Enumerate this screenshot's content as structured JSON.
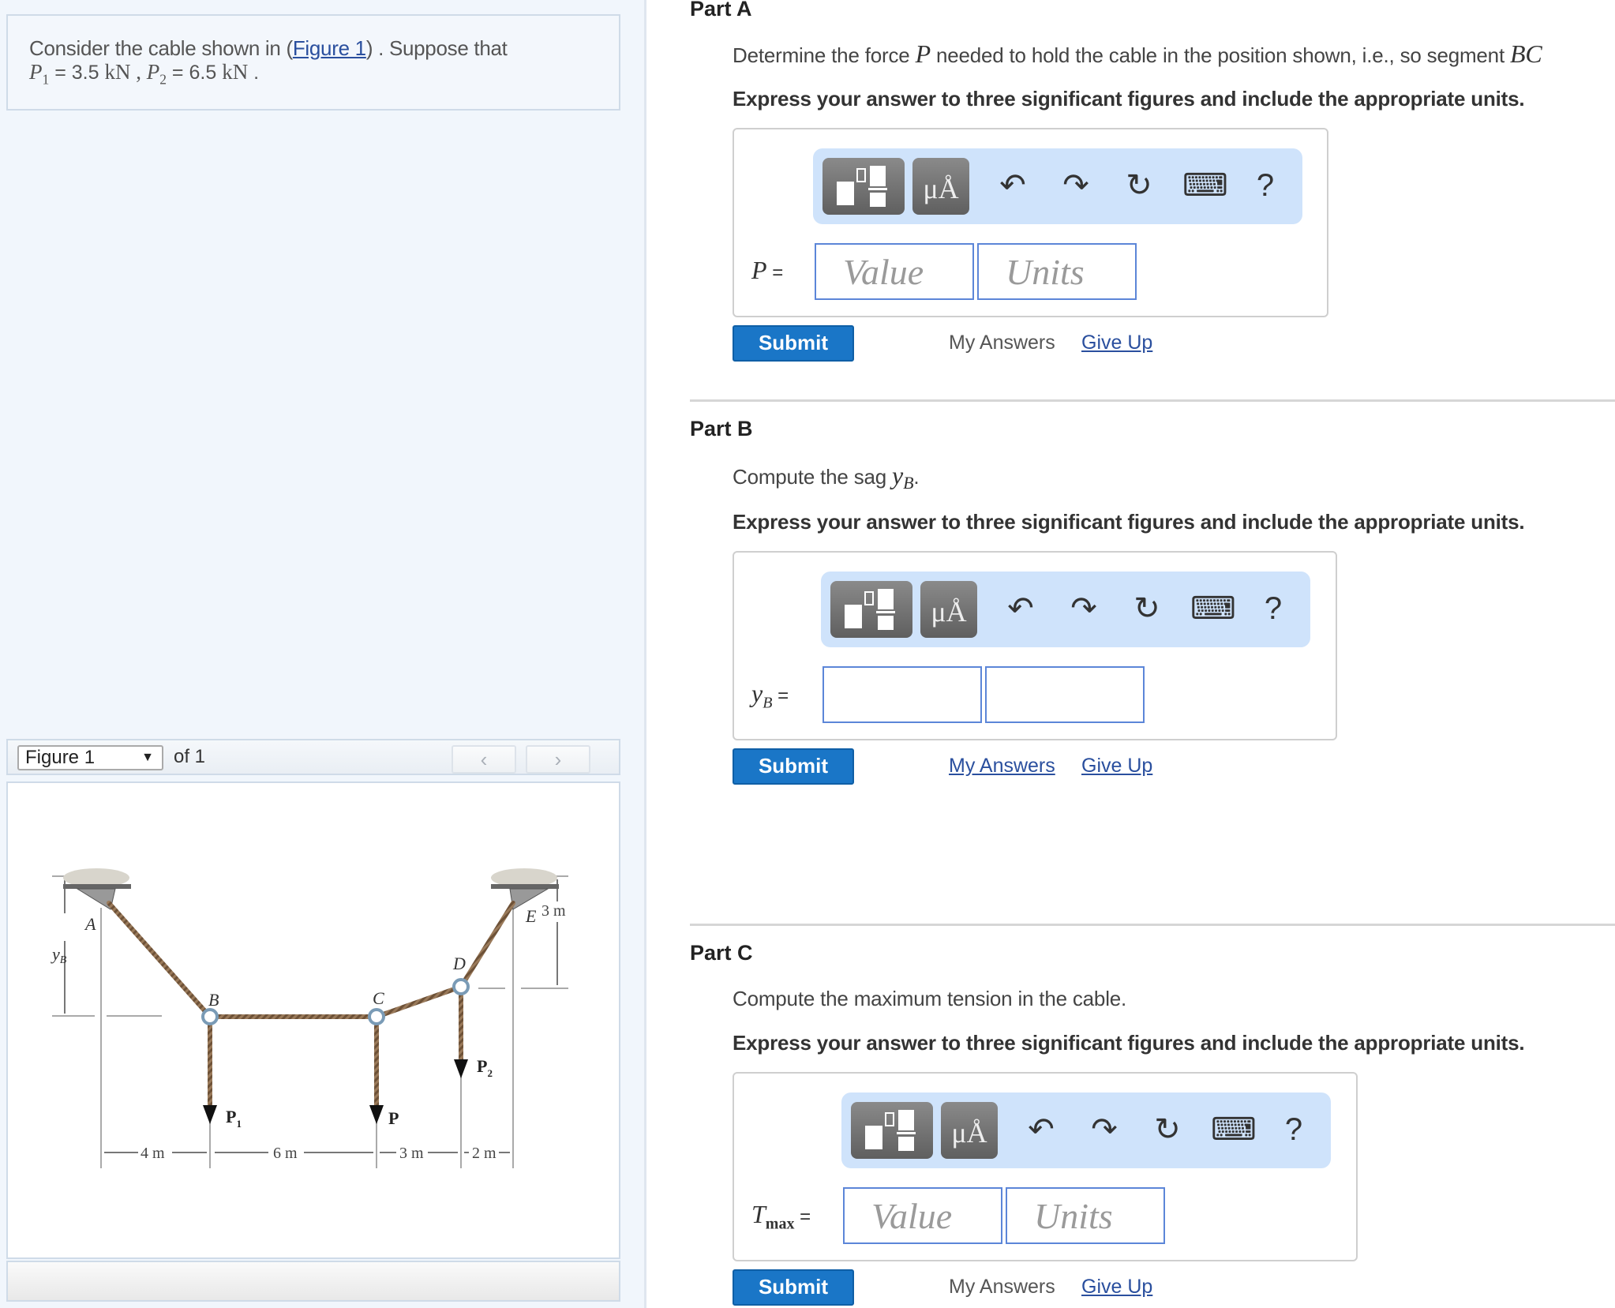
{
  "problem": {
    "line1_prefix": "Consider the cable shown in (",
    "figure_link": "Figure 1",
    "line1_suffix": ") . Suppose that",
    "p1_var": "P",
    "p1_sub": "1",
    "p1_value": " = 3.5 ",
    "p1_unit": "kN",
    "sep": " , ",
    "p2_var": "P",
    "p2_sub": "2",
    "p2_value": " = 6.5 ",
    "p2_unit": "kN",
    "end": " ."
  },
  "figure_nav": {
    "selected": "Figure 1",
    "caret": "▼",
    "of_label": "of 1",
    "prev": "‹",
    "next": "›"
  },
  "figure": {
    "labels": {
      "A": "A",
      "B": "B",
      "C": "C",
      "D": "D",
      "E": "E",
      "yB": "y",
      "yB_sub": "B",
      "P1": "P",
      "P1_sub": "1",
      "P": "P",
      "P2": "P",
      "P2_sub": "2",
      "dim_3m_vert": "3 m",
      "dim_4m": "4 m",
      "dim_6m": "6 m",
      "dim_3m": "3 m",
      "dim_2m": "2 m"
    }
  },
  "toolbar": {
    "units_label": "μÅ",
    "undo": "↶",
    "redo": "↷",
    "reset": "↻",
    "keyboard": "⌨",
    "help": "?"
  },
  "parts": [
    {
      "title": "Part A",
      "prompt_prefix": "Determine the force ",
      "prompt_math": "P",
      "prompt_suffix": " needed to hold the cable in the position shown, i.e., so segment ",
      "prompt_math2": "BC",
      "instruction": "Express your answer to three significant figures and include the appropriate units.",
      "label_var": "P",
      "label_sub": "",
      "label_eq": " =",
      "value_placeholder": "Value",
      "units_placeholder": "Units",
      "submit": "Submit",
      "my_answers": "My Answers",
      "give_up": "Give Up"
    },
    {
      "title": "Part B",
      "prompt_prefix": "Compute the sag ",
      "prompt_math": "y",
      "prompt_math_sub": "B",
      "prompt_suffix": ".",
      "instruction": "Express your answer to three significant figures and include the appropriate units.",
      "label_var": "y",
      "label_sub": "B",
      "label_eq": " =",
      "value_placeholder": "",
      "units_placeholder": "",
      "submit": "Submit",
      "my_answers": "My Answers",
      "give_up": "Give Up"
    },
    {
      "title": "Part C",
      "prompt_prefix": "Compute the maximum tension in the cable.",
      "instruction": "Express your answer to three significant figures and include the appropriate units.",
      "label_var": "T",
      "label_sub": "max",
      "label_eq": " =",
      "value_placeholder": "Value",
      "units_placeholder": "Units",
      "submit": "Submit",
      "my_answers": "My Answers",
      "give_up": "Give Up"
    }
  ],
  "colors": {
    "submit": "#1a76c7",
    "link": "#2a4f9e",
    "toolbar_bg": "#cfe3fb",
    "input_border": "#5c86d8",
    "panel_bg": "#f1f6fc"
  }
}
